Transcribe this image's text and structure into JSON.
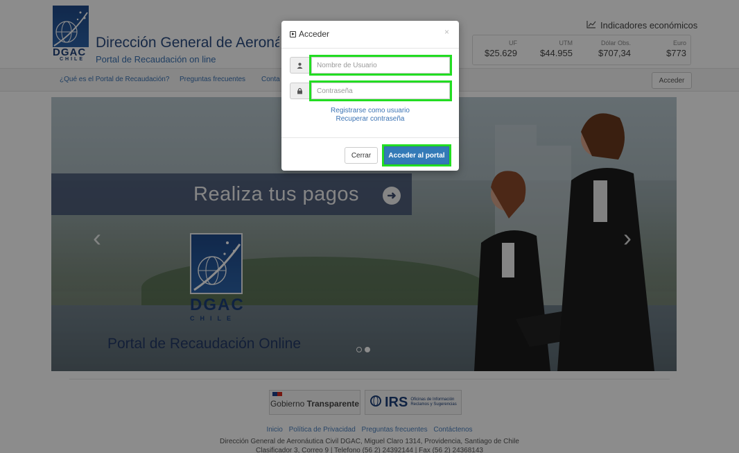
{
  "header": {
    "logo_text": "DGAC",
    "logo_subtext": "CHILE",
    "title": "Dirección General de Aeronáutica Civil",
    "subtitle": "Portal de Recaudación on line",
    "indicators_title": "Indicadores económicos",
    "indicators": [
      {
        "label": "UF",
        "value": "$25.629"
      },
      {
        "label": "UTM",
        "value": "$44.955"
      },
      {
        "label": "Dólar Obs.",
        "value": "$707,34"
      },
      {
        "label": "Euro",
        "value": "$773"
      }
    ]
  },
  "nav": {
    "items": [
      "¿Qué es el Portal de Recaudación?",
      "Preguntas frecuentes",
      "Conta"
    ],
    "login_label": "Acceder"
  },
  "carousel": {
    "banner_text": "Realiza tus pagos",
    "logo_text": "DGAC",
    "logo_subtext": "CHILE",
    "caption": "Portal de Recaudación Online",
    "active_slide": 2,
    "slide_count": 2
  },
  "footer": {
    "gob_label_light": "Gobierno",
    "gob_label_bold": "Transparente",
    "oirs_big": "IRS",
    "oirs_small_1": "Oficinas de Información",
    "oirs_small_2": "Reclamos y Sugerencias",
    "links": [
      "Inicio",
      "Política de Privacidad",
      "Preguntas frecuentes",
      "Contáctenos"
    ],
    "address": "Dirección General de Aeronáutica Civil DGAC, Miguel Claro 1314, Providencia, Santiago de Chile",
    "address2": "Clasificador 3, Correo 9 | Telefono (56 2) 24392144 | Fax (56 2) 24368143"
  },
  "modal": {
    "title": "Acceder",
    "close_symbol": "×",
    "username_placeholder": "Nombre de Usuario",
    "password_placeholder": "Contraseña",
    "register_link": "Registrarse como usuario",
    "recover_link": "Recuperar contraseña",
    "close_button": "Cerrar",
    "submit_button": "Acceder al portal",
    "highlight_color": "#22dd22"
  }
}
